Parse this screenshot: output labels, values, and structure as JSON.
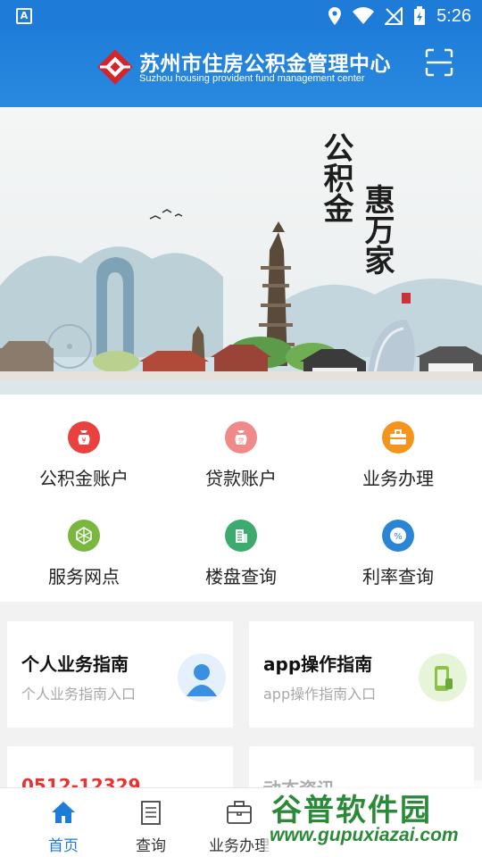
{
  "status_bar": {
    "time": "5:26"
  },
  "header": {
    "title_cn": "苏州市住房公积金管理中心",
    "title_en": "Suzhou housing provident fund management center"
  },
  "banner": {
    "calligraphy_left": "公积金",
    "calligraphy_right": "惠万家"
  },
  "menu": [
    {
      "label": "公积金账户",
      "icon": "yuan-bag-icon",
      "glyph": "¥",
      "color": "#e8413f"
    },
    {
      "label": "贷款账户",
      "icon": "loan-icon",
      "glyph": "贷",
      "color": "#f08a8a"
    },
    {
      "label": "业务办理",
      "icon": "briefcase-icon",
      "glyph": "",
      "color": "#f4941c"
    },
    {
      "label": "服务网点",
      "icon": "network-icon",
      "glyph": "",
      "color": "#7ab640"
    },
    {
      "label": "楼盘查询",
      "icon": "building-icon",
      "glyph": "",
      "color": "#3dab6d"
    },
    {
      "label": "利率查询",
      "icon": "percent-icon",
      "glyph": "%",
      "color": "#2a86d4"
    }
  ],
  "cards": [
    {
      "title": "个人业务指南",
      "subtitle": "个人业务指南入口"
    },
    {
      "title": "app操作指南",
      "subtitle": "app操作指南入口"
    },
    {
      "title": "0512-12329"
    },
    {
      "title": "动态资讯"
    }
  ],
  "bottom_nav": [
    {
      "label": "首页",
      "icon": "home-icon",
      "active": true,
      "active_color": "#1e7bd8"
    },
    {
      "label": "查询",
      "icon": "document-icon",
      "active": false
    },
    {
      "label": "业务办理",
      "icon": "briefcase-icon",
      "active": false
    }
  ],
  "watermark": {
    "top": "谷普软件园",
    "bottom": "www.gupuxiazai.com"
  }
}
